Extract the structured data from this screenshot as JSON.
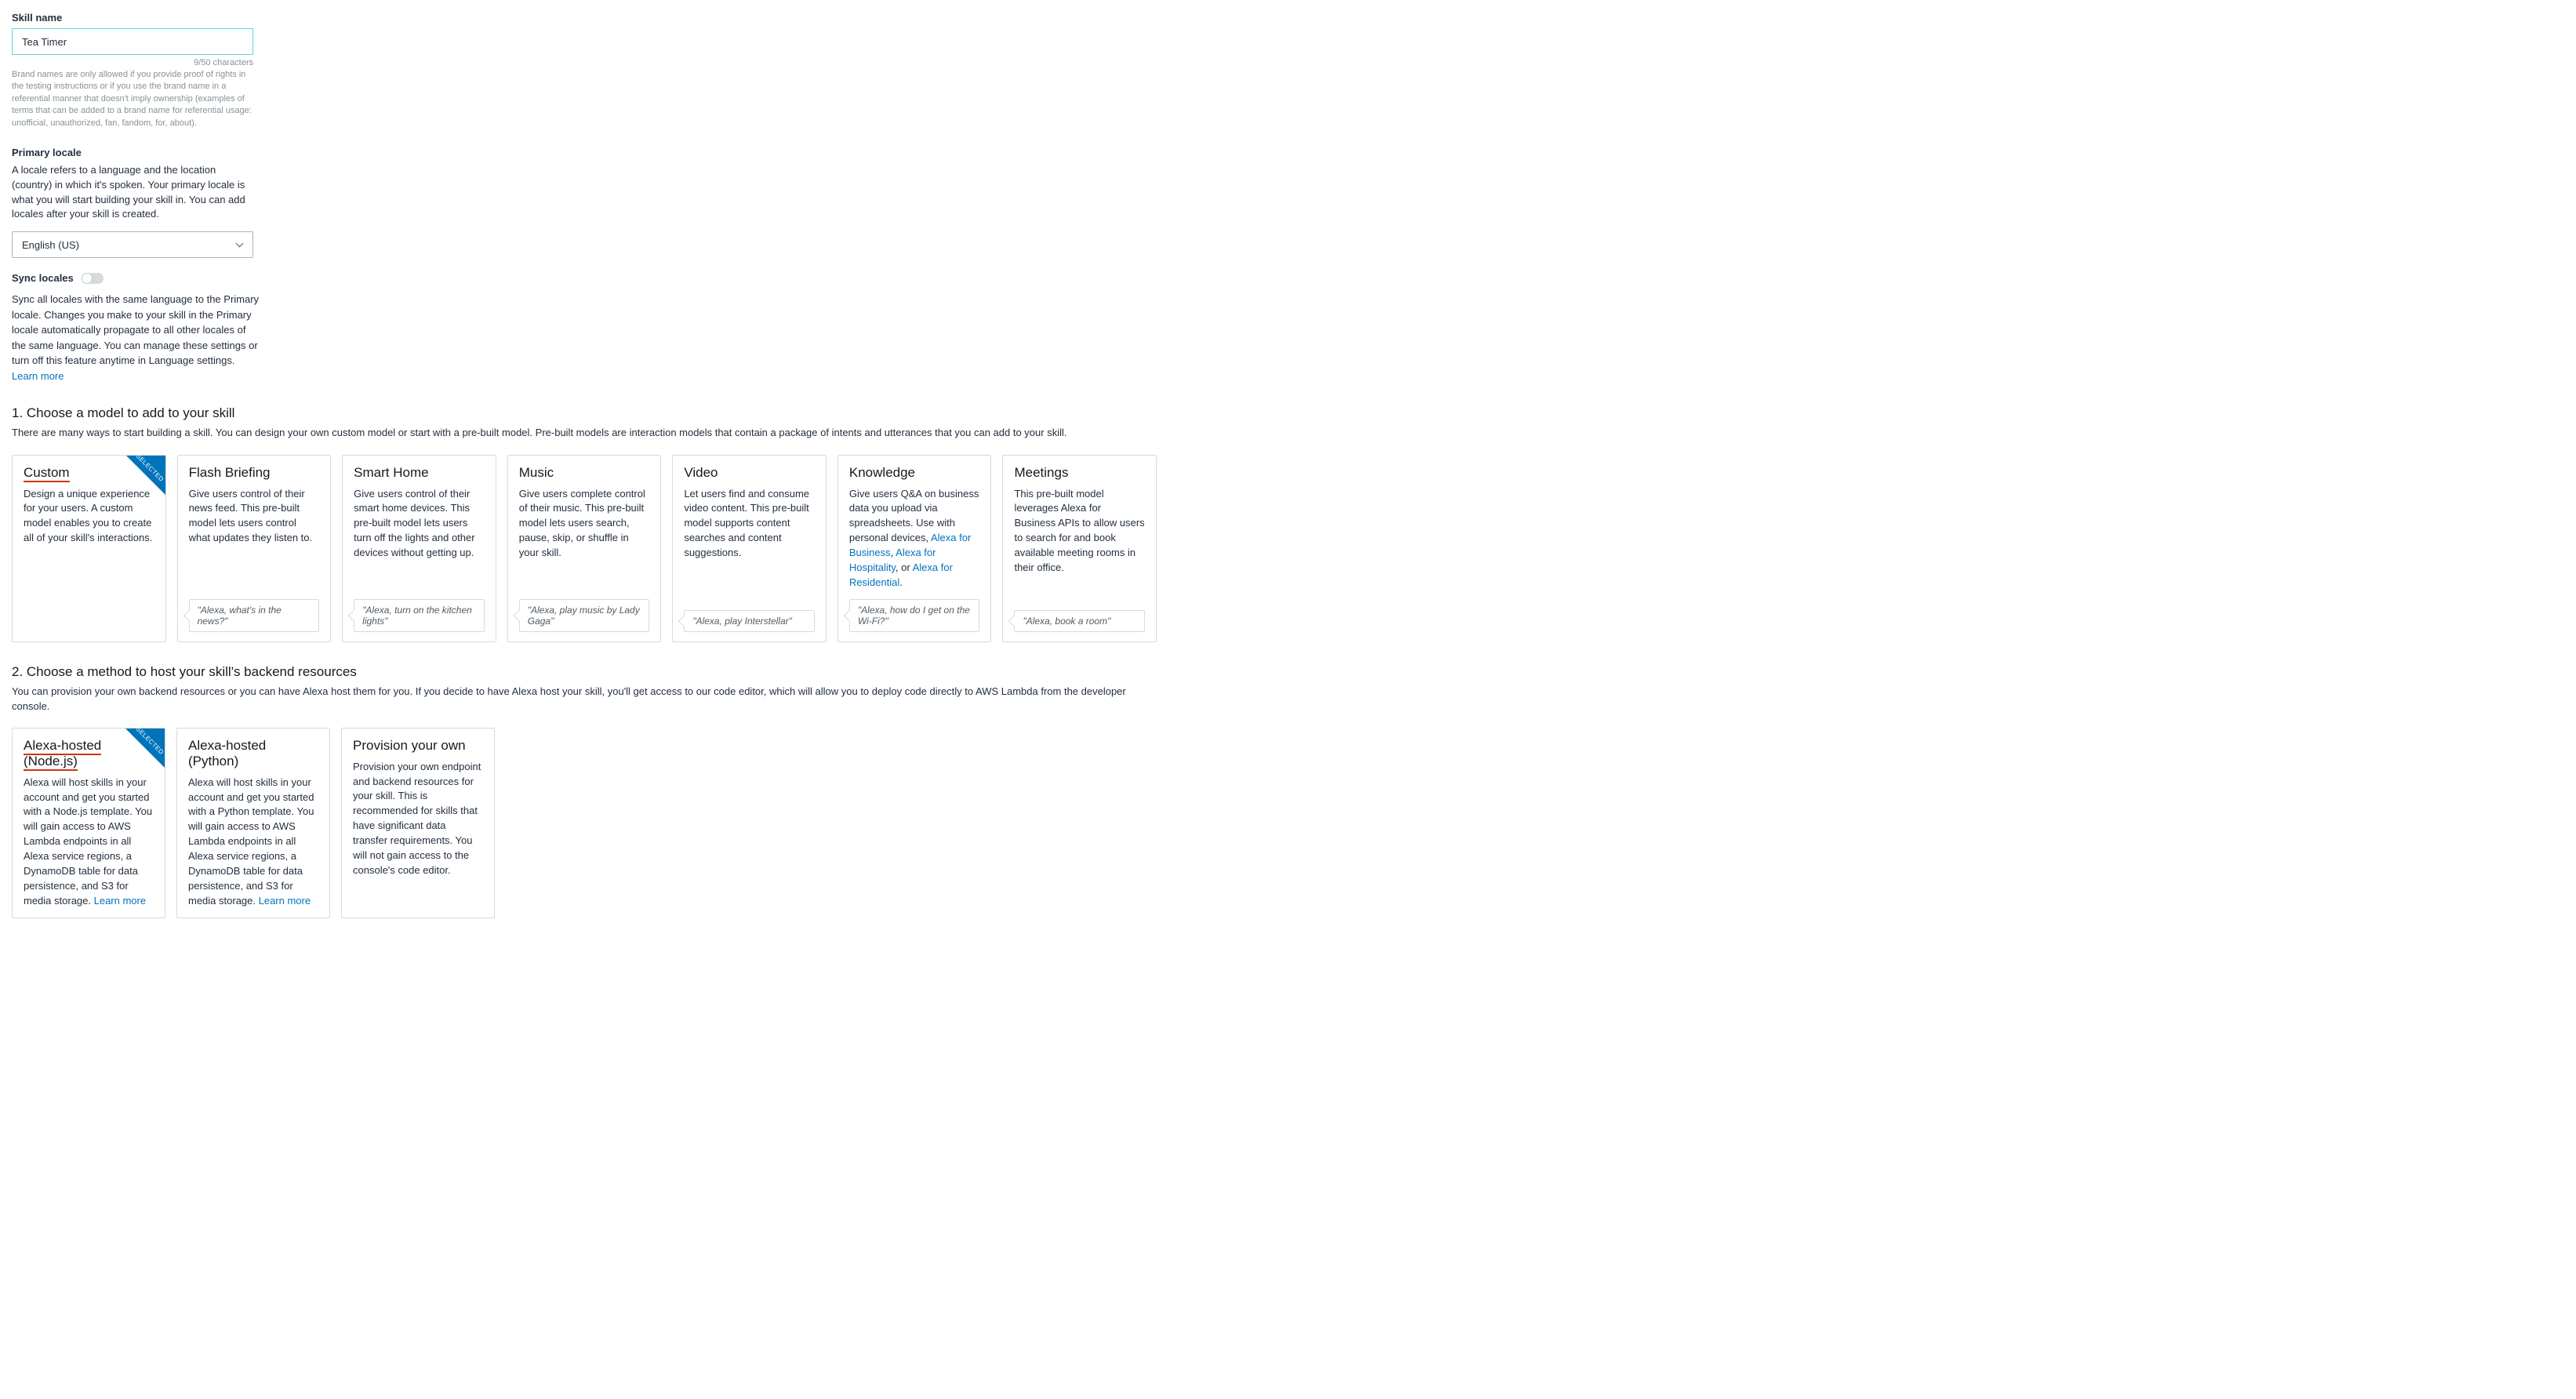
{
  "skillName": {
    "label": "Skill name",
    "value": "Tea Timer",
    "counter": "9/50  characters",
    "help": "Brand names are only allowed if you provide proof of rights in the testing instructions or if you use the brand name in a referential manner that doesn't imply ownership (examples of terms that can be added to a brand name for referential usage: unofficial, unauthorized, fan, fandom, for, about)."
  },
  "primaryLocale": {
    "label": "Primary locale",
    "desc": "A locale refers to a language and the location (country) in which it's spoken. Your primary locale is what you will start building your skill in. You can add locales after your skill is created.",
    "selected": "English (US)"
  },
  "syncLocales": {
    "label": "Sync locales",
    "desc": "Sync all locales with the same language to the Primary locale. Changes you make to your skill in the Primary locale automatically propagate to all other locales of the same language. You can manage these settings or turn off this feature anytime in Language settings. ",
    "learnMore": "Learn more"
  },
  "modelSection": {
    "heading": "1. Choose a model to add to your skill",
    "sub": "There are many ways to start building a skill. You can design your own custom model or start with a pre-built model.  Pre-built models are interaction models that contain a package of intents and utterances that you can add to your skill."
  },
  "models": [
    {
      "title": "Custom",
      "desc": "Design a unique experience for your users. A custom model enables you to create all of your skill's interactions.",
      "example": "",
      "selected": true,
      "redUnderline": true
    },
    {
      "title": "Flash Briefing",
      "desc": "Give users control of their news feed. This pre-built model lets users control what updates they listen to.",
      "example": "\"Alexa, what's in the news?\""
    },
    {
      "title": "Smart Home",
      "desc": "Give users control of their smart home devices. This pre-built model lets users turn off the lights and other devices without getting up.",
      "example": "\"Alexa, turn on the kitchen lights\""
    },
    {
      "title": "Music",
      "desc": "Give users complete control of their music. This pre-built model lets users search, pause, skip, or shuffle in your skill.",
      "example": "\"Alexa, play music by Lady Gaga\""
    },
    {
      "title": "Video",
      "desc": "Let users find and consume video content. This pre-built model supports content searches and content suggestions.",
      "example": "\"Alexa, play Interstellar\""
    },
    {
      "title": "Knowledge",
      "descPrefix": "Give users Q&A on business data you upload via spreadsheets. Use with personal devices, ",
      "links": [
        "Alexa for Business",
        "Alexa for Hospitality",
        "Alexa for Residential"
      ],
      "sep1": ", ",
      "sep2": ", or ",
      "sep3": ".",
      "example": "\"Alexa, how do I get on the Wi-Fi?\""
    },
    {
      "title": "Meetings",
      "desc": "This pre-built model leverages Alexa for Business APIs to allow users to search for and book available meeting rooms in their office.",
      "example": "\"Alexa, book a room\""
    }
  ],
  "hostSection": {
    "heading": "2. Choose a method to host your skill's backend resources",
    "sub": "You can provision your own backend resources or you can have Alexa host them for you. If you decide to have Alexa host your skill, you'll get access to our code editor, which will allow you to deploy code directly to AWS Lambda from the developer console."
  },
  "hosts": [
    {
      "title": "Alexa-hosted (Node.js)",
      "desc": "Alexa will host skills in your account and get you started with a Node.js template. You will gain access to AWS Lambda endpoints in all Alexa service regions, a DynamoDB table for data persistence, and S3 for media storage. ",
      "learnMore": "Learn more",
      "selected": true,
      "redUnderline": true
    },
    {
      "title": "Alexa-hosted (Python)",
      "desc": "Alexa will host skills in your account and get you started with a Python template. You will gain access to AWS Lambda endpoints in all Alexa service regions, a DynamoDB table for data persistence, and S3 for media storage. ",
      "learnMore": "Learn more"
    },
    {
      "title": "Provision your own",
      "desc": "Provision your own endpoint and backend resources for your skill. This is recommended for skills that have significant data transfer requirements. You will not gain access to the console's code editor."
    }
  ],
  "ribbon": "SELECTED"
}
